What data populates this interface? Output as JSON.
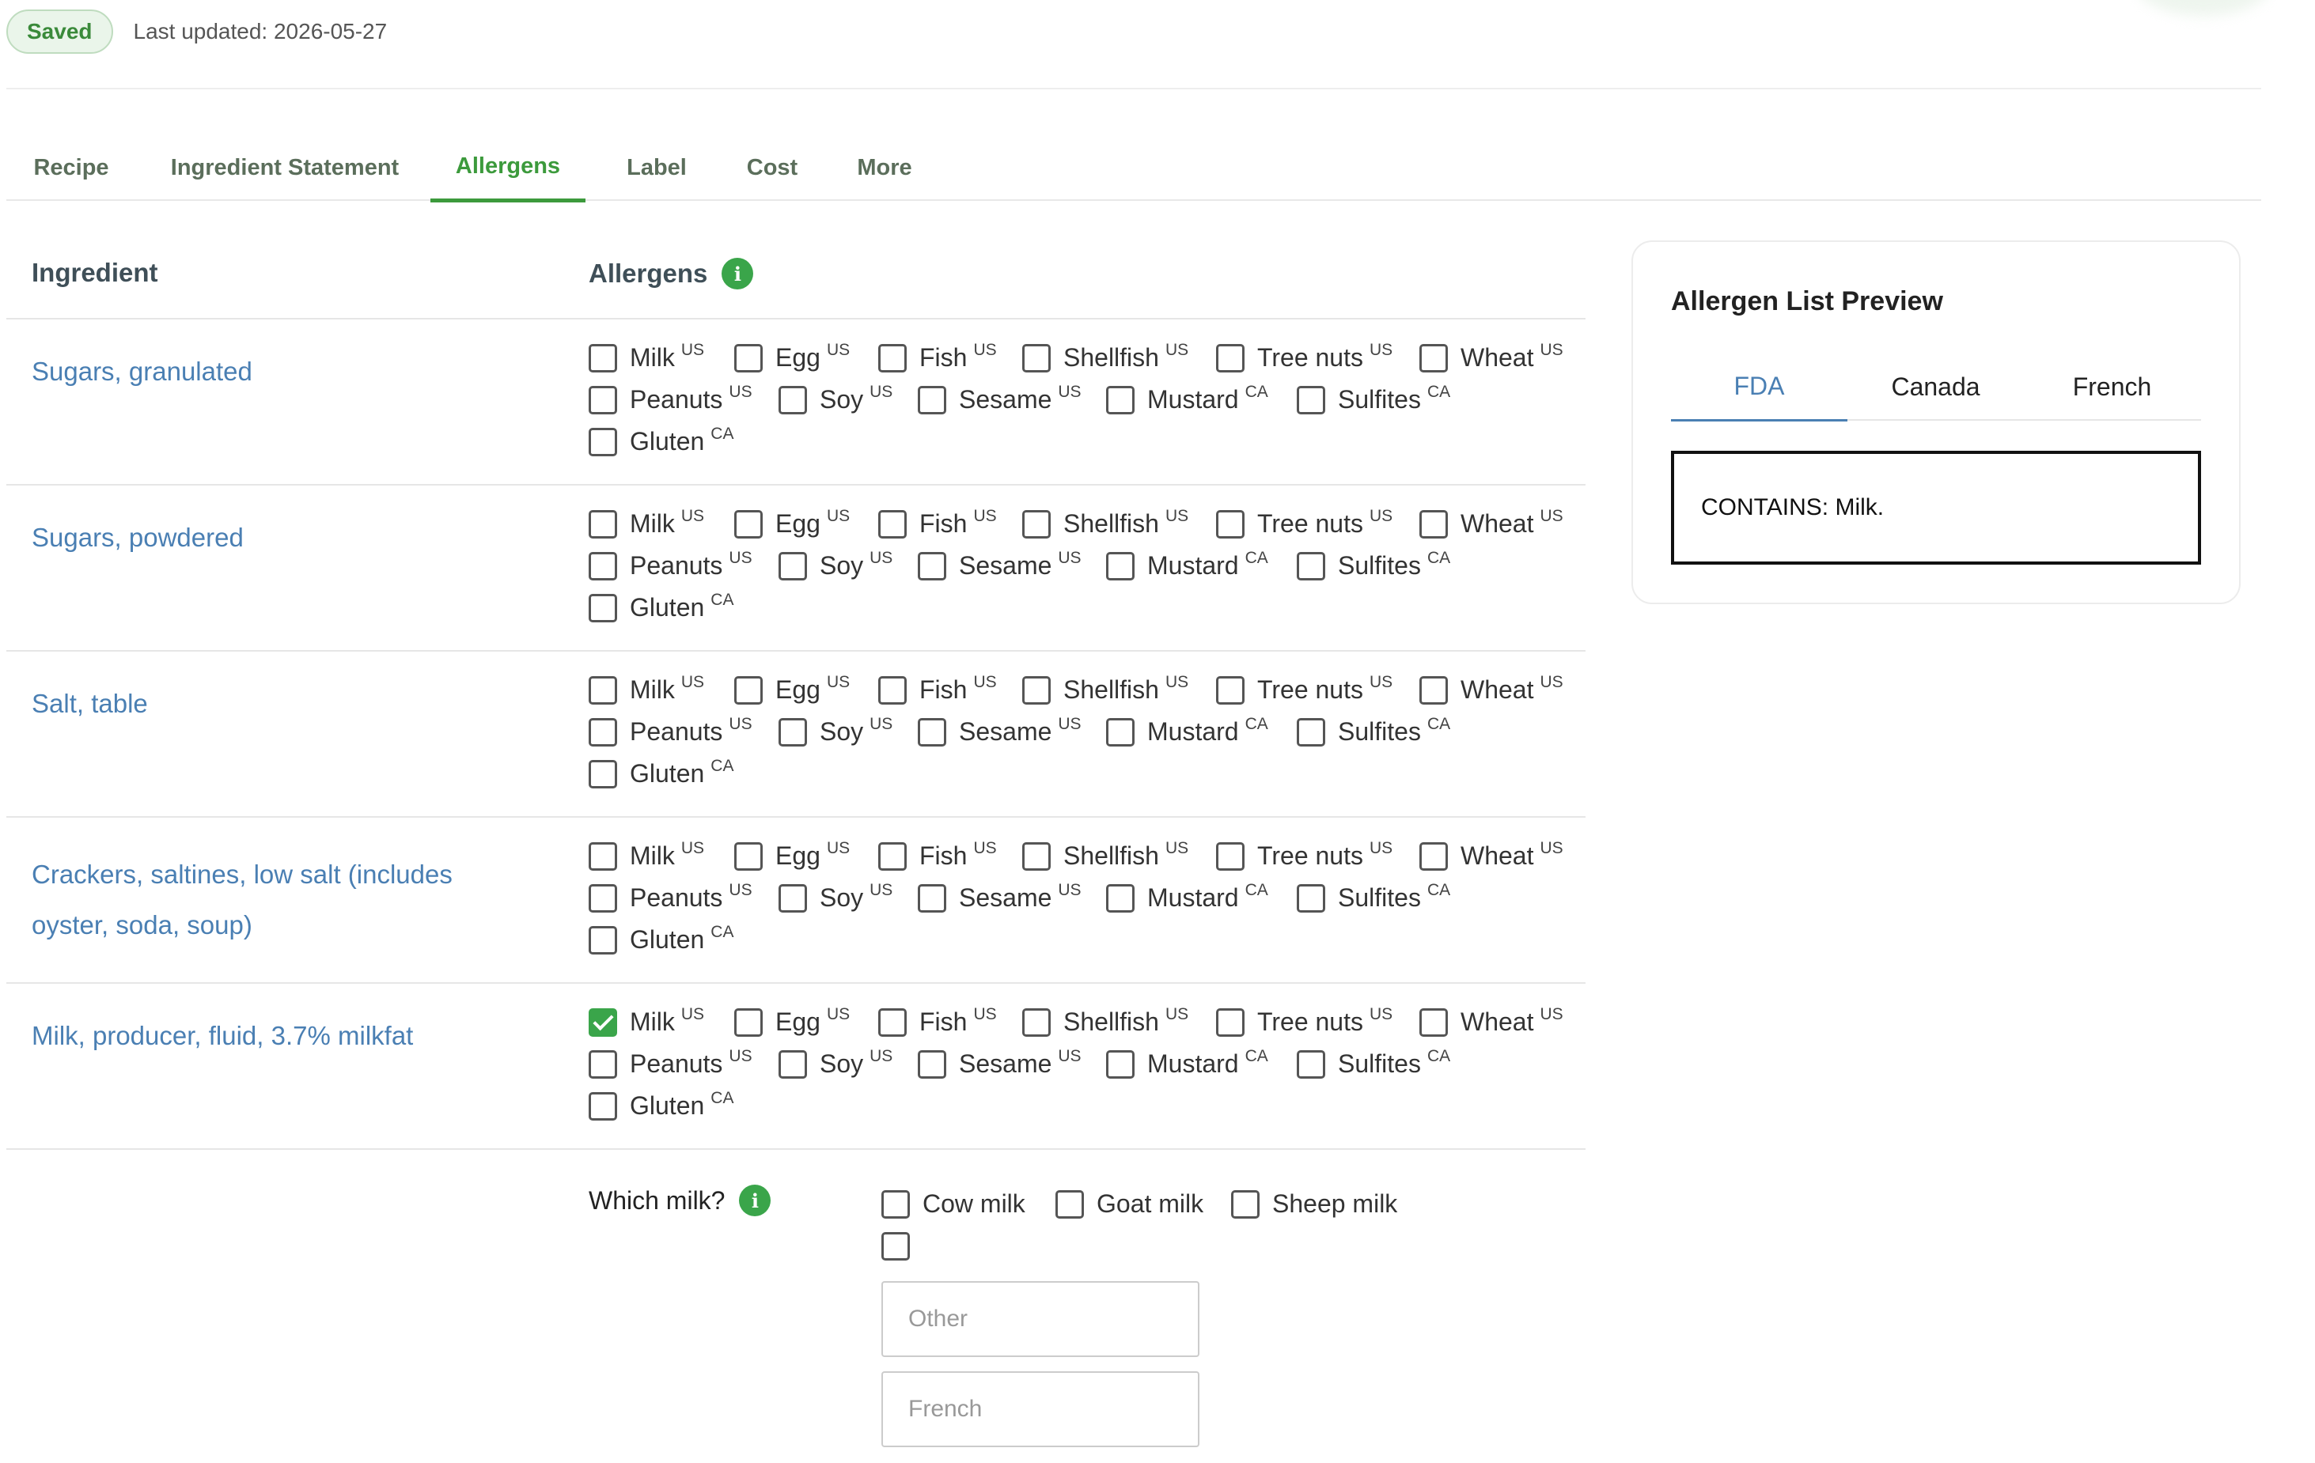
{
  "status": {
    "badge": "Saved",
    "last_updated": "Last updated: 2026-05-27"
  },
  "tabs": [
    {
      "label": "Recipe"
    },
    {
      "label": "Ingredient Statement"
    },
    {
      "label": "Allergens",
      "active": true
    },
    {
      "label": "Label"
    },
    {
      "label": "Cost"
    },
    {
      "label": "More"
    }
  ],
  "table": {
    "col_ingredient": "Ingredient",
    "col_allergens": "Allergens",
    "info_glyph": "i"
  },
  "allergens": [
    {
      "name": "Milk",
      "region": "US"
    },
    {
      "name": "Egg",
      "region": "US"
    },
    {
      "name": "Fish",
      "region": "US"
    },
    {
      "name": "Shellfish",
      "region": "US"
    },
    {
      "name": "Tree nuts",
      "region": "US"
    },
    {
      "name": "Wheat",
      "region": "US"
    },
    {
      "name": "Peanuts",
      "region": "US"
    },
    {
      "name": "Soy",
      "region": "US"
    },
    {
      "name": "Sesame",
      "region": "US"
    },
    {
      "name": "Mustard",
      "region": "CA"
    },
    {
      "name": "Sulfites",
      "region": "CA"
    },
    {
      "name": "Gluten",
      "region": "CA"
    }
  ],
  "ingredients": [
    {
      "name": "Sugars, granulated",
      "checked": []
    },
    {
      "name": "Sugars, powdered",
      "checked": []
    },
    {
      "name": "Salt, table",
      "checked": []
    },
    {
      "name": "Crackers, saltines, low salt (includes oyster, soda, soup)",
      "checked": []
    },
    {
      "name": "Milk, producer, fluid, 3.7% milkfat",
      "checked": [
        "Milk"
      ]
    }
  ],
  "milk": {
    "label": "Which milk?",
    "info_glyph": "i",
    "options": [
      {
        "label": "Cow milk"
      },
      {
        "label": "Goat milk"
      },
      {
        "label": "Sheep milk"
      }
    ],
    "other_placeholder": "Other",
    "french_placeholder": "French"
  },
  "preview": {
    "title": "Allergen List Preview",
    "tabs": [
      {
        "label": "FDA",
        "active": true
      },
      {
        "label": "Canada"
      },
      {
        "label": "French"
      }
    ],
    "contains": "CONTAINS: Milk."
  },
  "colors": {
    "accent_green": "#3aa54a",
    "link_blue": "#4a7fb3",
    "tab_green": "#3c9a3c"
  }
}
